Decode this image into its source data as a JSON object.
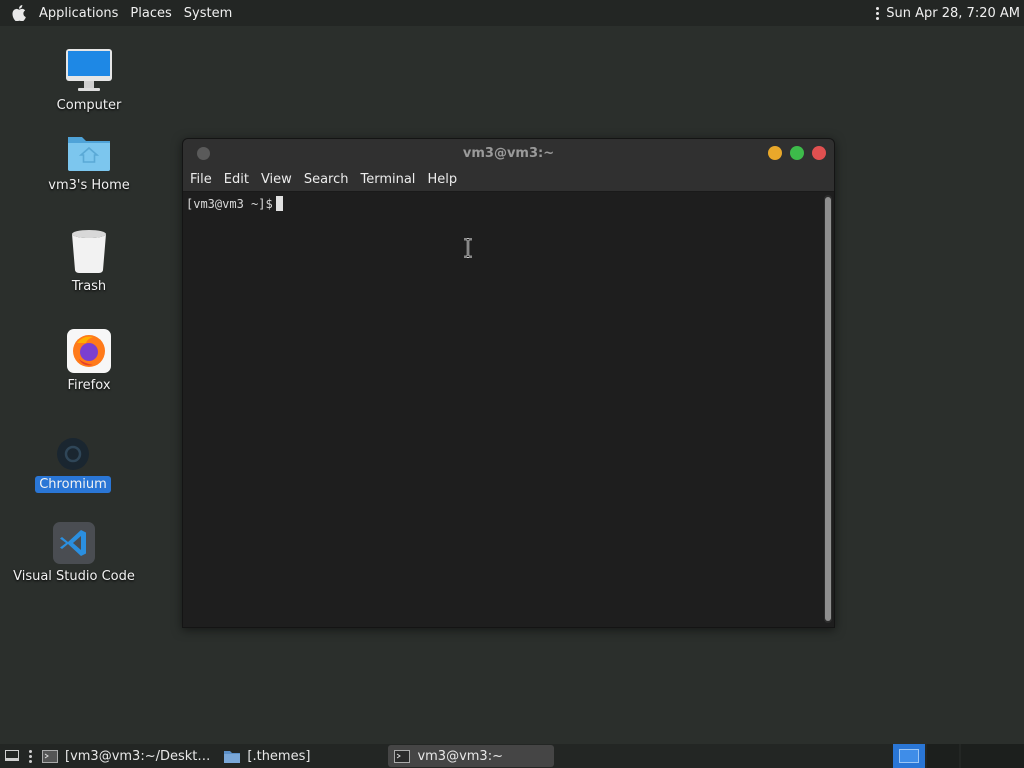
{
  "top_panel": {
    "menus": [
      "Applications",
      "Places",
      "System"
    ],
    "clock": "Sun Apr 28,  7:20 AM"
  },
  "desktop": {
    "icons": [
      {
        "label": "Computer",
        "icon": "computer-icon"
      },
      {
        "label": "vm3's Home",
        "icon": "home-folder-icon"
      },
      {
        "label": "Trash",
        "icon": "trash-icon"
      },
      {
        "label": "Firefox",
        "icon": "firefox-icon"
      },
      {
        "label": "Chromium",
        "icon": "chromium-icon",
        "selected": true
      },
      {
        "label": "Visual Studio Code",
        "icon": "vscode-icon"
      }
    ]
  },
  "terminal": {
    "title": "vm3@vm3:~",
    "menu": [
      "File",
      "Edit",
      "View",
      "Search",
      "Terminal",
      "Help"
    ],
    "prompt": "[vm3@vm3 ~]$"
  },
  "taskbar": {
    "tasks": [
      {
        "label": "[vm3@vm3:~/Deskt…",
        "icon": "terminal-icon",
        "active": false
      },
      {
        "label": "[.themes]",
        "icon": "folder-icon",
        "active": false
      },
      {
        "label": "vm3@vm3:~",
        "icon": "terminal-icon",
        "active": true
      }
    ]
  },
  "colors": {
    "desktop_bg": "#2b2f2c",
    "selection": "#2a76d6",
    "close": "#e05050",
    "maximize": "#3dbb4a",
    "minimize": "#e9a82a"
  }
}
